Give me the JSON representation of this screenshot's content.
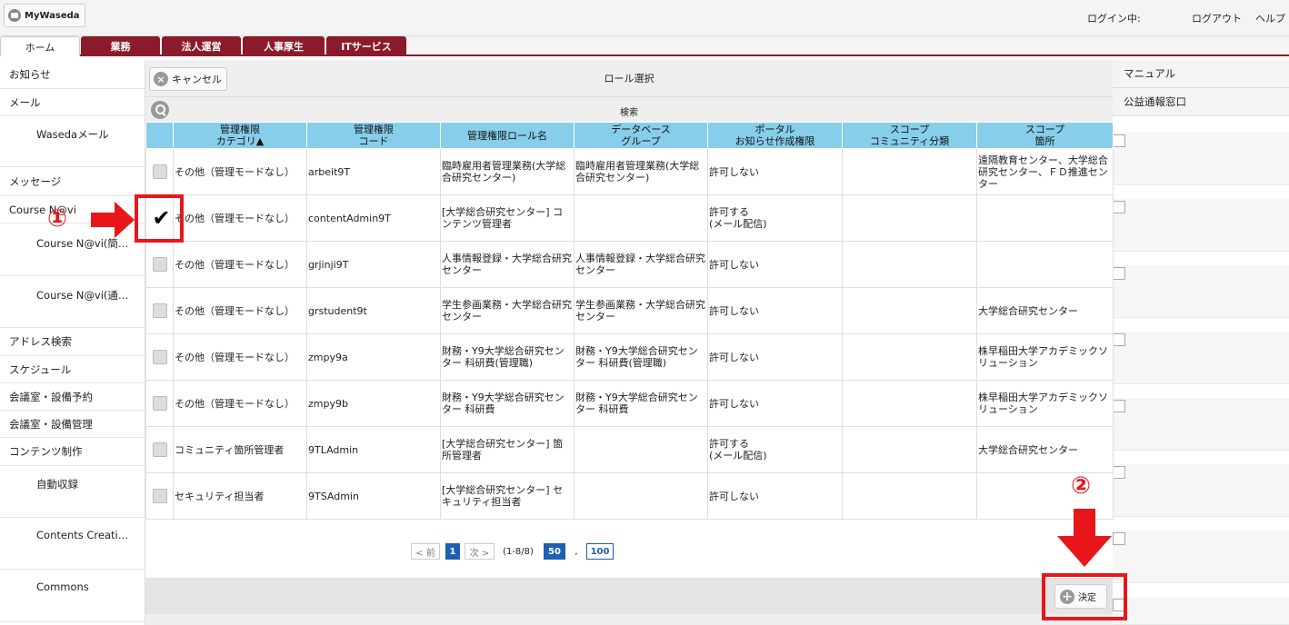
{
  "header": {
    "home_label": "MyWaseda",
    "login_status": "ログイン中:",
    "logout": "ログアウト",
    "help": "ヘルプ"
  },
  "tabs": [
    {
      "label": "ホーム"
    },
    {
      "label": "業務"
    },
    {
      "label": "法人運営"
    },
    {
      "label": "人事厚生"
    },
    {
      "label": "ITサービス"
    }
  ],
  "sidebar": {
    "items": [
      {
        "label": "お知らせ"
      },
      {
        "label": "メール"
      },
      {
        "label": "Wasedaメール"
      },
      {
        "label": "メッセージ"
      },
      {
        "label": "Course N@vi"
      },
      {
        "label": "Course N@vi(簡…"
      },
      {
        "label": "Course N@vi(通…"
      },
      {
        "label": "アドレス検索"
      },
      {
        "label": "スケジュール"
      },
      {
        "label": "会議室・設備予約"
      },
      {
        "label": "会議室・設備管理"
      },
      {
        "label": "コンテンツ制作"
      },
      {
        "label": "自動収録"
      },
      {
        "label": "Contents Creati…"
      },
      {
        "label": "Commons"
      }
    ]
  },
  "rightbar": {
    "items": [
      {
        "label": "マニュアル"
      },
      {
        "label": "公益通報窓口"
      }
    ]
  },
  "dialog": {
    "cancel_label": "キャンセル",
    "title": "ロール選択",
    "search_label": "検索",
    "decide_label": "決定"
  },
  "table": {
    "headers": [
      "",
      "管理権限\nカテゴリ▲",
      "管理権限\nコード",
      "管理権限ロール名",
      "データベース\nグループ",
      "ポータル\nお知らせ作成権限",
      "スコープ\nコミュニティ分類",
      "スコープ\n箇所"
    ],
    "rows": [
      {
        "checked": false,
        "category": "その他（管理モードなし）",
        "code": "arbeit9T",
        "role": "臨時雇用者管理業務(大学総合研究センター)",
        "db": "臨時雇用者管理業務(大学総合研究センター)",
        "portal": "許可しない",
        "community": "",
        "scope": "遠隔教育センター、大学総合研究センター、ＦＤ推進センター"
      },
      {
        "checked": true,
        "category": "その他（管理モードなし）",
        "code": "contentAdmin9T",
        "role": "[大学総合研究センター] コンテンツ管理者",
        "db": "",
        "portal": "許可する\n(メール配信)",
        "community": "",
        "scope": ""
      },
      {
        "checked": false,
        "category": "その他（管理モードなし）",
        "code": "grjinji9T",
        "role": "人事情報登録・大学総合研究センター",
        "db": "人事情報登録・大学総合研究センター",
        "portal": "許可しない",
        "community": "",
        "scope": ""
      },
      {
        "checked": false,
        "category": "その他（管理モードなし）",
        "code": "grstudent9t",
        "role": "学生参画業務・大学総合研究センター",
        "db": "学生参画業務・大学総合研究センター",
        "portal": "許可しない",
        "community": "",
        "scope": "大学総合研究センター"
      },
      {
        "checked": false,
        "category": "その他（管理モードなし）",
        "code": "zmpy9a",
        "role": "財務・Y9大学総合研究センター 科研費(管理職)",
        "db": "財務・Y9大学総合研究センター 科研費(管理職)",
        "portal": "許可しない",
        "community": "",
        "scope": "株早稲田大学アカデミックソリューション"
      },
      {
        "checked": false,
        "category": "その他（管理モードなし）",
        "code": "zmpy9b",
        "role": "財務・Y9大学総合研究センター 科研費",
        "db": "財務・Y9大学総合研究センター 科研費",
        "portal": "許可しない",
        "community": "",
        "scope": "株早稲田大学アカデミックソリューション"
      },
      {
        "checked": false,
        "category": "コミュニティ箇所管理者",
        "code": "9TLAdmin",
        "role": "[大学総合研究センター] 箇所管理者",
        "db": "",
        "portal": "許可する\n(メール配信)",
        "community": "",
        "scope": "大学総合研究センター"
      },
      {
        "checked": false,
        "category": "セキュリティ担当者",
        "code": "9TSAdmin",
        "role": "[大学総合研究センター] セキュリティ担当者",
        "db": "",
        "portal": "許可しない",
        "community": "",
        "scope": ""
      }
    ]
  },
  "pager": {
    "prev": "< 前",
    "current": "1",
    "next": "次 >",
    "range": "(1-8/8)",
    "size_50": "50",
    "separator": ",",
    "size_100": "100"
  },
  "annotations": {
    "marker_1": "①",
    "marker_2": "②",
    "highlight_color": "#e8151b"
  }
}
